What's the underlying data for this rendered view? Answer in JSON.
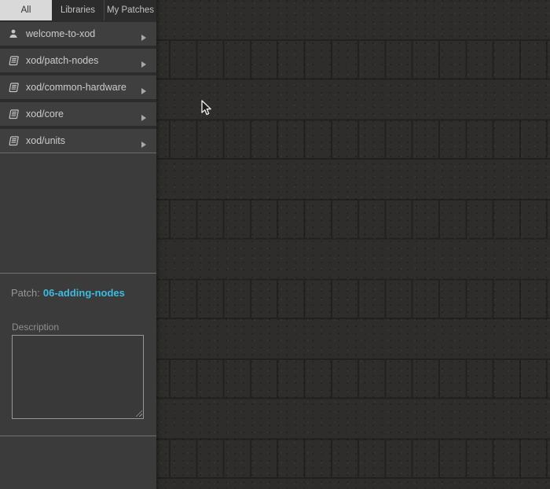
{
  "sidebar": {
    "tabs": [
      {
        "label": "All",
        "active": true
      },
      {
        "label": "Libraries",
        "active": false
      },
      {
        "label": "My Patches",
        "active": false
      }
    ],
    "items": [
      {
        "label": "welcome-to-xod",
        "icon": "user-icon"
      },
      {
        "label": "xod/patch-nodes",
        "icon": "book-icon"
      },
      {
        "label": "xod/common-hardware",
        "icon": "book-icon"
      },
      {
        "label": "xod/core",
        "icon": "book-icon"
      },
      {
        "label": "xod/units",
        "icon": "book-icon"
      }
    ],
    "patch": {
      "label": "Patch:",
      "name": "06-adding-nodes"
    },
    "description": {
      "label": "Description",
      "value": ""
    }
  },
  "canvas": {
    "cursor_icon": "arrow-pointer"
  },
  "colors": {
    "accent_link": "#3cbcdf",
    "tab_active_bg": "#d9d9d9",
    "sidebar_bg": "#3b3b3b",
    "canvas_bg": "#2e2d2b",
    "grid_line": "#232120"
  }
}
